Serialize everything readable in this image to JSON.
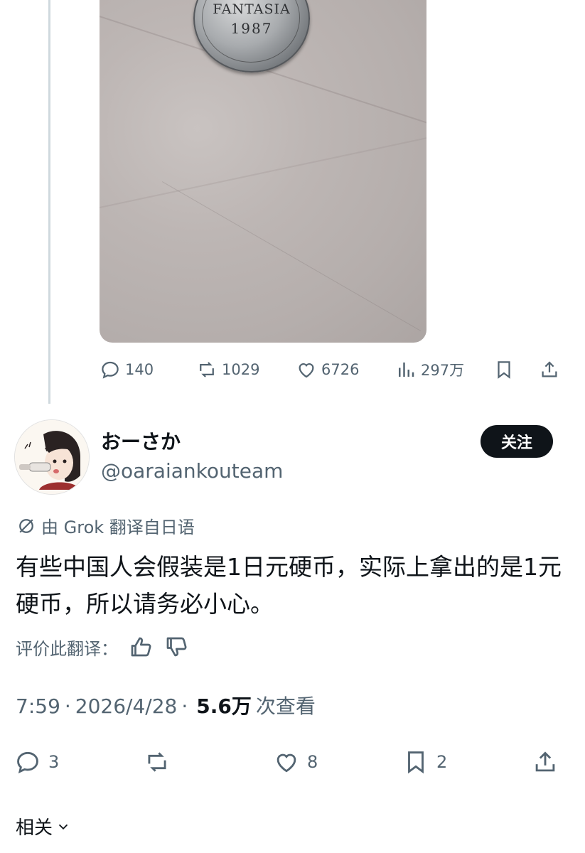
{
  "parent_tweet": {
    "coin": {
      "line1": "FANTASIA",
      "line2": "1987"
    },
    "actions": {
      "replies": "140",
      "retweets": "1029",
      "likes": "6726",
      "views": "297万"
    }
  },
  "tweet": {
    "author": {
      "display_name": "おーさか",
      "handle": "@oaraiankouteam"
    },
    "follow_label": "关注",
    "translation_note": "由 Grok 翻译自日语",
    "text": "有些中国人会假装是1日元硬币，实际上拿出的是1元硬币，所以请务必小心。",
    "rate_label": "评价此翻译：",
    "meta": {
      "time": "7:59",
      "date": "2026/4/28",
      "views": "5.6万",
      "views_suffix": "次查看"
    },
    "actions": {
      "replies": "3",
      "likes": "8",
      "bookmarks": "2"
    }
  },
  "related_label": "相关",
  "colors": {
    "text": "#0f1419",
    "secondary": "#536471",
    "follow_bg": "#0f1419",
    "thread_line": "#cfd9de"
  }
}
